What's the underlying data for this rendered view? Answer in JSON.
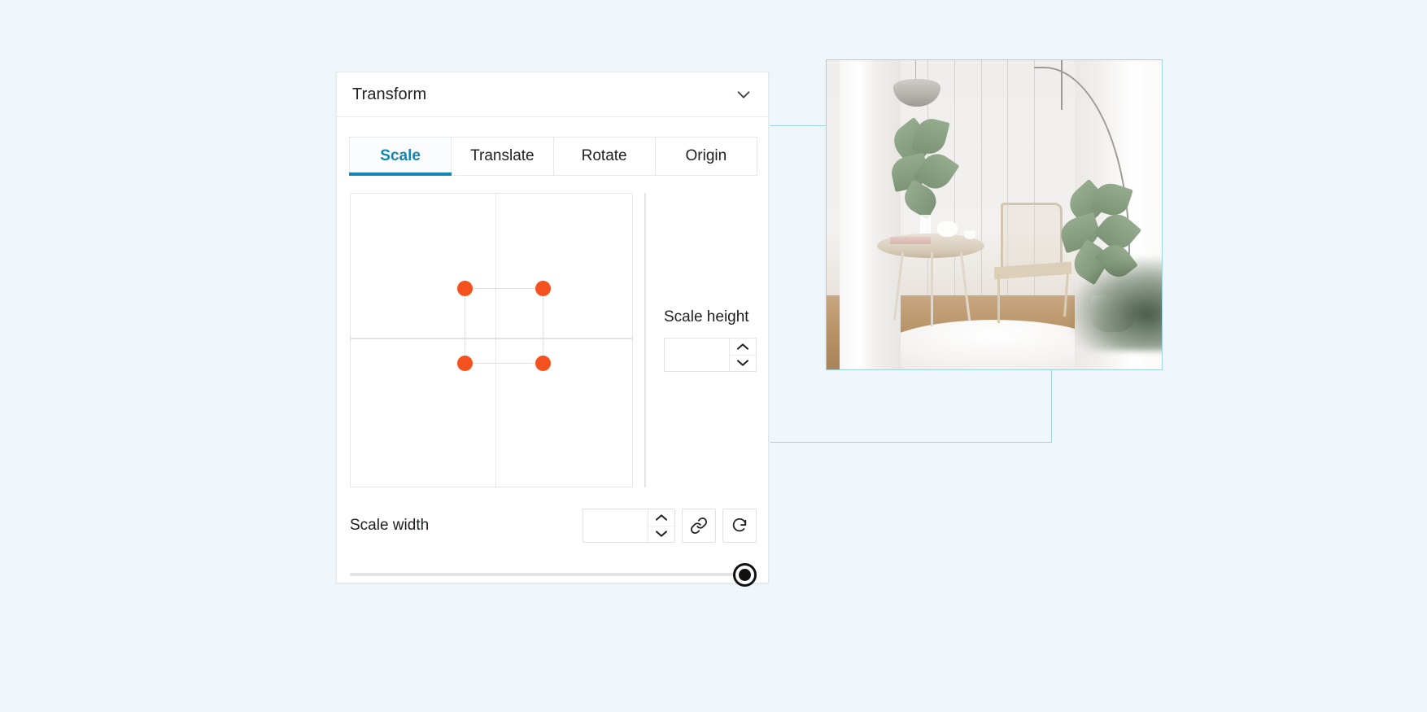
{
  "panel": {
    "title": "Transform",
    "collapse_icon": "chevron-down-icon"
  },
  "tabs": [
    {
      "label": "Scale",
      "active": true
    },
    {
      "label": "Translate",
      "active": false
    },
    {
      "label": "Rotate",
      "active": false
    },
    {
      "label": "Origin",
      "active": false
    }
  ],
  "scale_grid": {
    "handle_color": "#f4511e",
    "handles": [
      {
        "name": "top-left"
      },
      {
        "name": "top-right"
      },
      {
        "name": "bottom-left"
      },
      {
        "name": "bottom-right"
      }
    ]
  },
  "scale_height": {
    "label": "Scale height",
    "value": "",
    "placeholder": "",
    "increment_icon": "chevron-up-icon",
    "decrement_icon": "chevron-down-icon"
  },
  "scale_width": {
    "label": "Scale width",
    "value": "",
    "placeholder": "",
    "increment_icon": "chevron-up-icon",
    "decrement_icon": "chevron-down-icon"
  },
  "actions": {
    "link_icon": "link-icon",
    "reset_icon": "refresh-icon"
  },
  "slider": {
    "thumb_position_percent": 100
  },
  "preview": {
    "alt": "interior-room-photo",
    "border_color": "#9ed3e0"
  },
  "colors": {
    "background": "#eff7fc",
    "accent": "#1286b5",
    "handle": "#f4511e",
    "connector": "#9ed3e0"
  }
}
